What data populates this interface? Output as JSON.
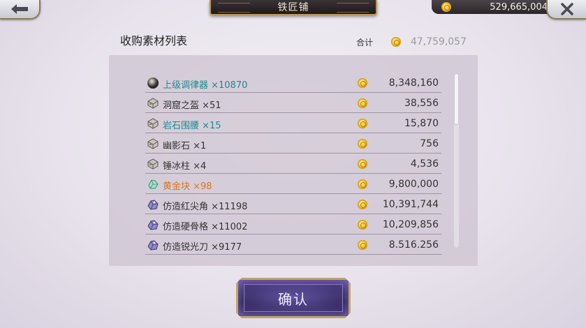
{
  "header": {
    "title": "铁匠铺",
    "currency_amount": "529,665,004"
  },
  "list": {
    "title": "收购素材列表",
    "total_label": "合计",
    "total_value": "47,759,057"
  },
  "items": [
    {
      "name": "上级调律器 ×10870",
      "price": "8,348,160",
      "color": "blue",
      "icon": "sphere-icon"
    },
    {
      "name": "洞窟之盔 ×51",
      "price": "38,556",
      "color": "normal",
      "icon": "armor-icon"
    },
    {
      "name": "岩石围腰 ×15",
      "price": "15,870",
      "color": "blue",
      "icon": "armor-icon"
    },
    {
      "name": "幽影石 ×1",
      "price": "756",
      "color": "normal",
      "icon": "armor-icon"
    },
    {
      "name": "锤冰柱 ×4",
      "price": "4,536",
      "color": "normal",
      "icon": "armor-icon"
    },
    {
      "name": "黄金块 ×98",
      "price": "9,800,000",
      "color": "orange",
      "icon": "crystal-icon"
    },
    {
      "name": "仿造红尖角 ×11198",
      "price": "10,391,744",
      "color": "normal",
      "icon": "ore-icon"
    },
    {
      "name": "仿造硬骨格 ×11002",
      "price": "10,209,856",
      "color": "normal",
      "icon": "ore-icon"
    },
    {
      "name": "仿造锐光刀 ×9177",
      "price": "8.516.256",
      "color": "normal",
      "icon": "ore-icon"
    }
  ],
  "confirm_label": "确认",
  "colors": {
    "blue_item": "#1f8a8c",
    "orange_item": "#d6771d",
    "gold_border": "#c2a468",
    "button_purple": "#2b2250"
  }
}
